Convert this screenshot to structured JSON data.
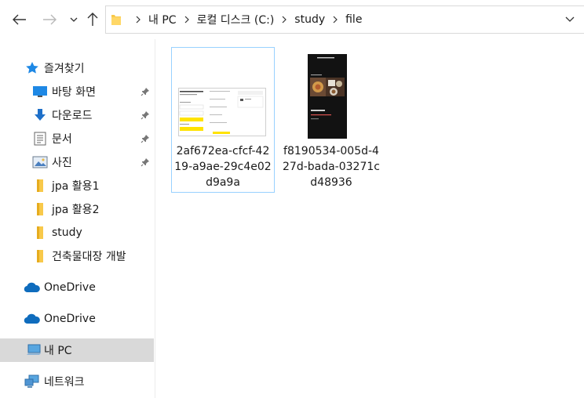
{
  "address_bar": {
    "breadcrumbs": [
      "내 PC",
      "로컬 디스크 (C:)",
      "study",
      "file"
    ]
  },
  "sidebar": {
    "quick_access": {
      "label": "즐겨찾기"
    },
    "pinned_items": [
      {
        "label": "바탕 화면",
        "icon": "desktop-icon"
      },
      {
        "label": "다운로드",
        "icon": "download-arrow-icon"
      },
      {
        "label": "문서",
        "icon": "document-icon"
      },
      {
        "label": "사진",
        "icon": "pictures-icon"
      }
    ],
    "folders": [
      {
        "label": "jpa 활용1"
      },
      {
        "label": "jpa 활용2"
      },
      {
        "label": "study"
      },
      {
        "label": "건축물대장 개발"
      }
    ],
    "onedrive_1": {
      "label": "OneDrive"
    },
    "onedrive_2": {
      "label": "OneDrive"
    },
    "this_pc": {
      "label": "내 PC"
    },
    "network": {
      "label": "네트워크"
    }
  },
  "files": [
    {
      "name": "2af672ea-cfcf-4219-a9ae-29c4e02d9a9a",
      "selected": true,
      "thumbnail": "web-form-screenshot"
    },
    {
      "name": "f8190534-005d-427d-bada-03271cd48936",
      "selected": false,
      "thumbnail": "dark-mobile-app-screenshot"
    }
  ],
  "colors": {
    "selection_border": "#99d1ff",
    "folder_yellow": "#f8c94a",
    "onedrive_blue": "#0f6cbd",
    "accent_yellow": "#ffe300"
  }
}
